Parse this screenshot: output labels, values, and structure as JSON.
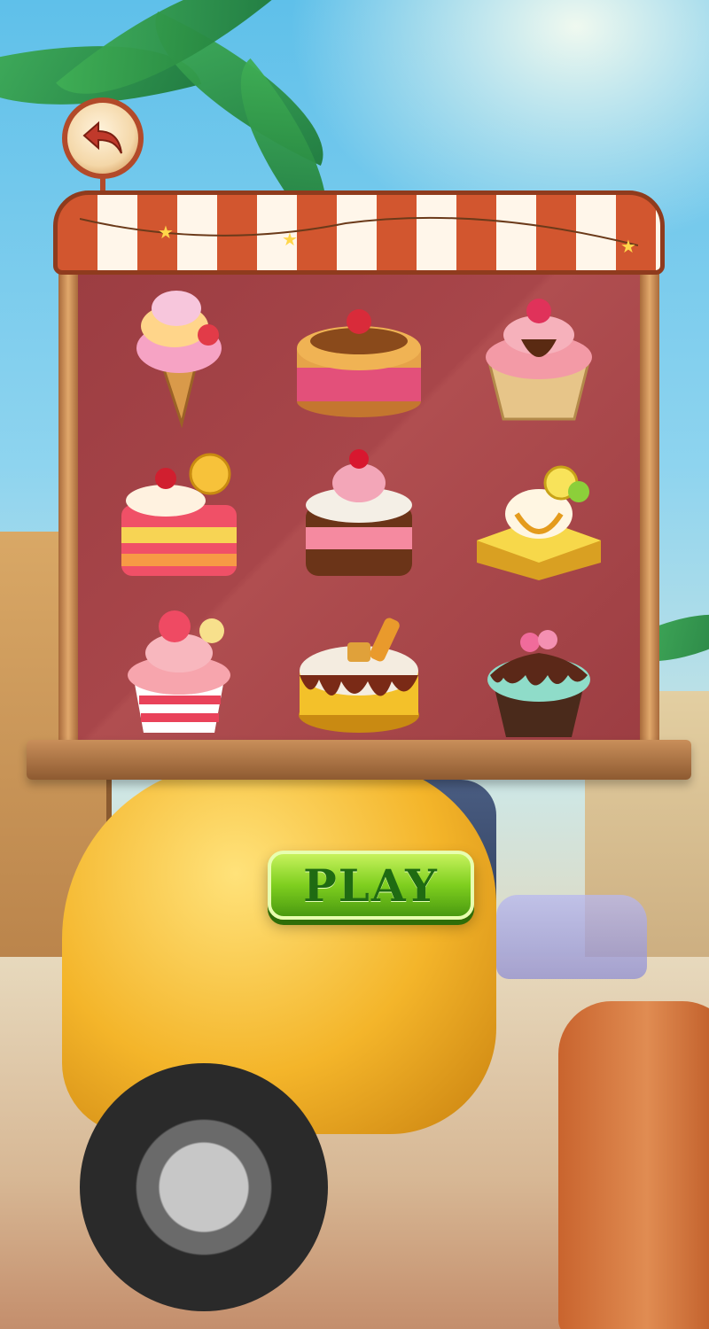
{
  "screen": "dessert-select",
  "back_button": {
    "icon": "back-arrow-icon"
  },
  "play_button": {
    "label": "PLAY",
    "color": "#7fcf1f"
  },
  "stall": {
    "awning_colors": [
      "#d2562f",
      "#fff6ea"
    ],
    "panel_color": "#9c3d42"
  },
  "desserts": [
    {
      "name": "strawberry-ice-cream-cone",
      "icon": "ice-cream-icon"
    },
    {
      "name": "strawberry-layer-cake",
      "icon": "cake-icon"
    },
    {
      "name": "raspberry-cupcake",
      "icon": "cupcake-icon"
    },
    {
      "name": "pineapple-jelly-slice",
      "icon": "cake-slice-icon"
    },
    {
      "name": "chocolate-cream-cake",
      "icon": "cake-icon"
    },
    {
      "name": "lemon-tart",
      "icon": "tart-icon"
    },
    {
      "name": "cherry-cupcake",
      "icon": "cupcake-icon"
    },
    {
      "name": "caramel-drip-cake",
      "icon": "cake-icon"
    },
    {
      "name": "mint-rose-cupcake",
      "icon": "cupcake-icon"
    }
  ]
}
